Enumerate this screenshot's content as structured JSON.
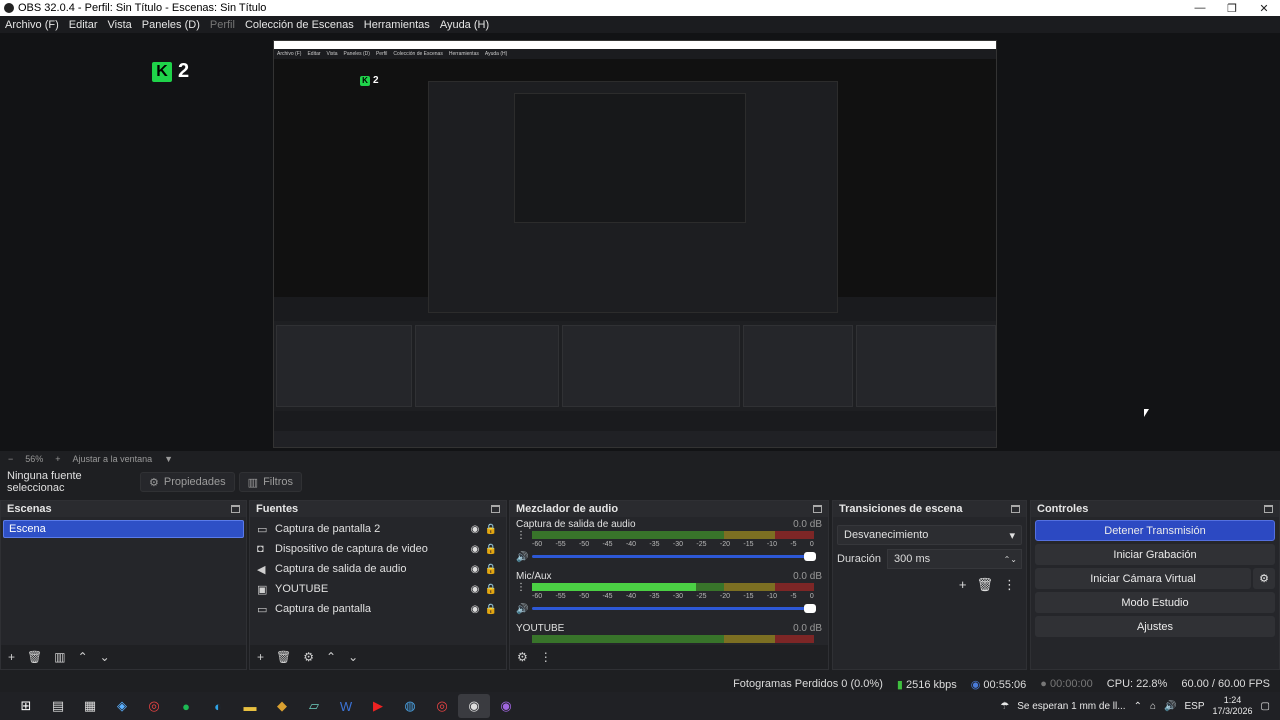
{
  "window": {
    "title": "OBS 32.0.4 - Perfil: Sin Título - Escenas: Sin Título",
    "controls": [
      "—",
      "❐",
      "✕"
    ]
  },
  "menu": [
    {
      "label": "Archivo (F)",
      "enabled": true
    },
    {
      "label": "Editar",
      "enabled": true
    },
    {
      "label": "Vista",
      "enabled": true
    },
    {
      "label": "Paneles (D)",
      "enabled": true
    },
    {
      "label": "Perfil",
      "enabled": false
    },
    {
      "label": "Colección de Escenas",
      "enabled": true
    },
    {
      "label": "Herramientas",
      "enabled": true
    },
    {
      "label": "Ayuda (H)",
      "enabled": true
    }
  ],
  "preview": {
    "overlay_text": "2",
    "nested_menu": [
      "Archivo (F)",
      "Editar",
      "Vista",
      "Paneles (D)",
      "Perfil",
      "Colección de Escenas",
      "Herramientas",
      "Ayuda (H)"
    ]
  },
  "zoom": {
    "minus": "−",
    "level": "56%",
    "plus": "+",
    "fit": "Ajustar a la ventana"
  },
  "source_bar": {
    "no_selection": "Ninguna fuente seleccionac",
    "properties": "Propiedades",
    "filters": "Filtros"
  },
  "scenes": {
    "title": "Escenas",
    "items": [
      "Escena"
    ]
  },
  "sources": {
    "title": "Fuentes",
    "items": [
      {
        "label": "Captura de pantalla 2",
        "icon": "monitor-icon"
      },
      {
        "label": "Dispositivo de captura de video",
        "icon": "camera-icon"
      },
      {
        "label": "Captura de salida de audio",
        "icon": "speaker-icon"
      },
      {
        "label": "YOUTUBE",
        "icon": "browser-icon"
      },
      {
        "label": "Captura de pantalla",
        "icon": "monitor-icon"
      }
    ]
  },
  "mixer": {
    "title": "Mezclador de audio",
    "scale": [
      "-60",
      "-55",
      "-50",
      "-45",
      "-40",
      "-35",
      "-30",
      "-25",
      "-20",
      "-15",
      "-10",
      "-5",
      "0"
    ],
    "channels": [
      {
        "name": "Captura de salida de audio",
        "db": "0.0 dB",
        "level": 0.0
      },
      {
        "name": "Mic/Aux",
        "db": "0.0 dB",
        "level": 0.58
      },
      {
        "name": "YOUTUBE",
        "db": "0.0 dB",
        "level": 0.0
      }
    ]
  },
  "transitions": {
    "title": "Transiciones de escena",
    "selected": "Desvanecimiento",
    "duration_label": "Duración",
    "duration_value": "300 ms"
  },
  "controls": {
    "title": "Controles",
    "stream": "Detener Transmisión",
    "record": "Iniciar Grabación",
    "virtual_cam": "Iniciar Cámara Virtual",
    "studio": "Modo Estudio",
    "settings": "Ajustes"
  },
  "status": {
    "dropped": "Fotogramas Perdidos 0 (0.0%)",
    "bitrate": "2516 kbps",
    "stream_time": "00:55:06",
    "rec_time": "00:00:00",
    "cpu": "CPU: 22.8%",
    "fps": "60.00 / 60.00 FPS"
  },
  "taskbar": {
    "weather": "Se esperan 1 mm de ll...",
    "lang": "ESP",
    "time": "1:24",
    "date": "17/3/2026"
  },
  "colors": {
    "accent": "#2c49c2",
    "meter_green": "#4bd044",
    "k_logo": "#1fd34a"
  }
}
